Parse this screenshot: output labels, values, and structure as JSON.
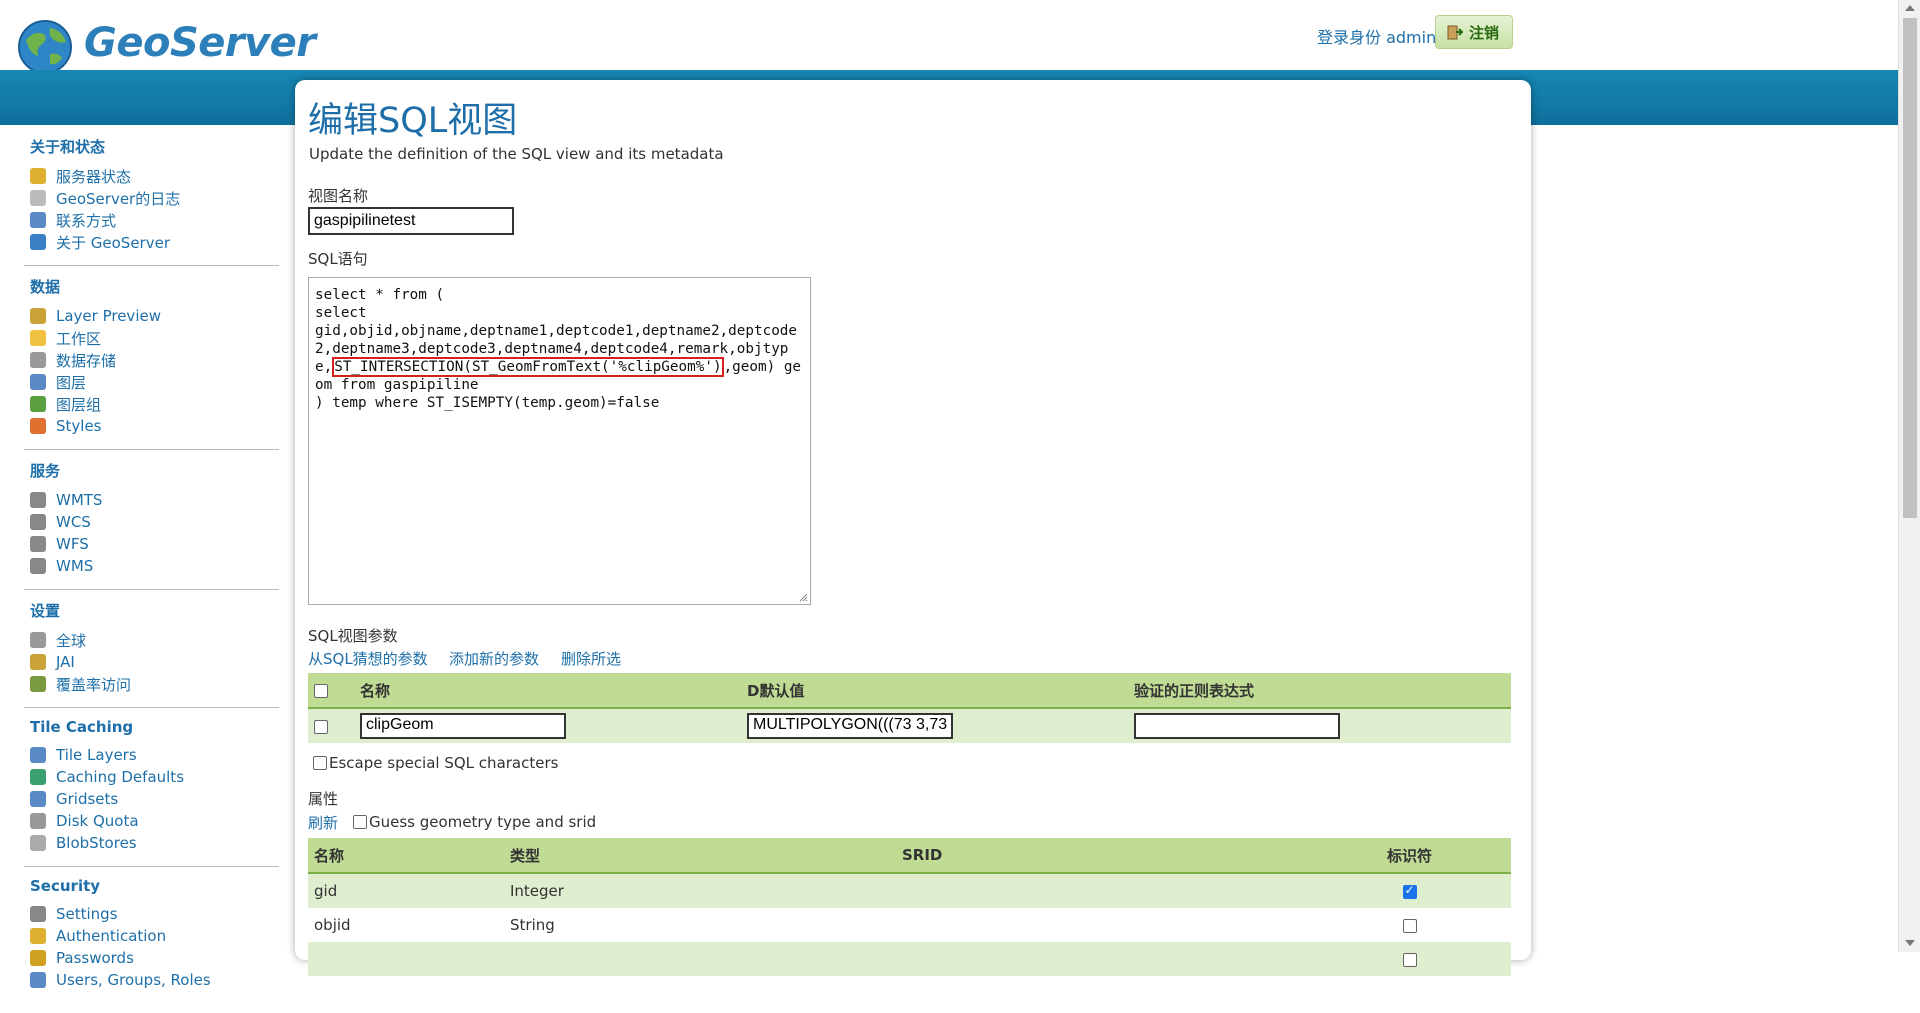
{
  "header": {
    "logo_text": "GeoServer",
    "login_text": "登录身份 admin.",
    "logout_label": "注销"
  },
  "sidebar": {
    "sections": [
      {
        "title": "关于和状态",
        "items": [
          {
            "label": "服务器状态",
            "icon": "status-icon"
          },
          {
            "label": "GeoServer的日志",
            "icon": "log-icon"
          },
          {
            "label": "联系方式",
            "icon": "contact-icon"
          },
          {
            "label": "关于 GeoServer",
            "icon": "about-icon"
          }
        ]
      },
      {
        "title": "数据",
        "items": [
          {
            "label": "Layer Preview",
            "icon": "layer-preview-icon"
          },
          {
            "label": "工作区",
            "icon": "workspace-icon"
          },
          {
            "label": "数据存储",
            "icon": "datastore-icon"
          },
          {
            "label": "图层",
            "icon": "layer-icon"
          },
          {
            "label": "图层组",
            "icon": "layergroup-icon"
          },
          {
            "label": "Styles",
            "icon": "styles-icon"
          }
        ]
      },
      {
        "title": "服务",
        "items": [
          {
            "label": "WMTS",
            "icon": "service-icon"
          },
          {
            "label": "WCS",
            "icon": "service-icon"
          },
          {
            "label": "WFS",
            "icon": "service-icon"
          },
          {
            "label": "WMS",
            "icon": "service-icon"
          }
        ]
      },
      {
        "title": "设置",
        "items": [
          {
            "label": "全球",
            "icon": "global-icon"
          },
          {
            "label": "JAI",
            "icon": "jai-icon"
          },
          {
            "label": "覆盖率访问",
            "icon": "coverage-icon"
          }
        ]
      },
      {
        "title": "Tile Caching",
        "items": [
          {
            "label": "Tile Layers",
            "icon": "tile-layers-icon"
          },
          {
            "label": "Caching Defaults",
            "icon": "caching-defaults-icon"
          },
          {
            "label": "Gridsets",
            "icon": "gridsets-icon"
          },
          {
            "label": "Disk Quota",
            "icon": "disk-quota-icon"
          },
          {
            "label": "BlobStores",
            "icon": "blobstores-icon"
          }
        ]
      },
      {
        "title": "Security",
        "items": [
          {
            "label": "Settings",
            "icon": "settings-icon"
          },
          {
            "label": "Authentication",
            "icon": "authentication-icon"
          },
          {
            "label": "Passwords",
            "icon": "passwords-icon"
          },
          {
            "label": "Users, Groups, Roles",
            "icon": "users-icon"
          }
        ]
      }
    ]
  },
  "main": {
    "title": "编辑SQL视图",
    "description": "Update the definition of the SQL view and its metadata",
    "view_name_label": "视图名称",
    "view_name_value": "gaspipilinetest",
    "sql_label": "SQL语句",
    "sql_before": "select * from (\nselect\ngid,objid,objname,deptname1,deptcode1,deptname2,deptcode2,deptname3,deptcode3,deptname4,deptcode4,remark,objtype,",
    "sql_highlight": "ST_INTERSECTION(ST_GeomFromText('%clipGeom%')",
    "sql_after": ",geom) geom from gaspipiline\n) temp where ST_ISEMPTY(temp.geom)=false",
    "params_label": "SQL视图参数",
    "param_links": [
      "从SQL猜想的参数",
      "添加新的参数",
      "删除所选"
    ],
    "params_table": {
      "headers": [
        "名称",
        "D默认值",
        "验证的正则表达式"
      ],
      "rows": [
        {
          "checked": false,
          "name": "clipGeom",
          "default": "MULTIPOLYGON(((73 3,73 ",
          "regex": ""
        }
      ]
    },
    "escape_label": "Escape special SQL characters",
    "escape_checked": false,
    "attributes_label": "属性",
    "refresh_label": "刷新",
    "guess_label": "Guess geometry type and srid",
    "guess_checked": false,
    "attr_table": {
      "headers": [
        "名称",
        "类型",
        "SRID",
        "标识符"
      ],
      "rows": [
        {
          "name": "gid",
          "type": "Integer",
          "srid": "",
          "identifier": true
        },
        {
          "name": "objid",
          "type": "String",
          "srid": "",
          "identifier": false
        },
        {
          "name": "",
          "type": "",
          "srid": "",
          "identifier": false
        }
      ]
    }
  }
}
